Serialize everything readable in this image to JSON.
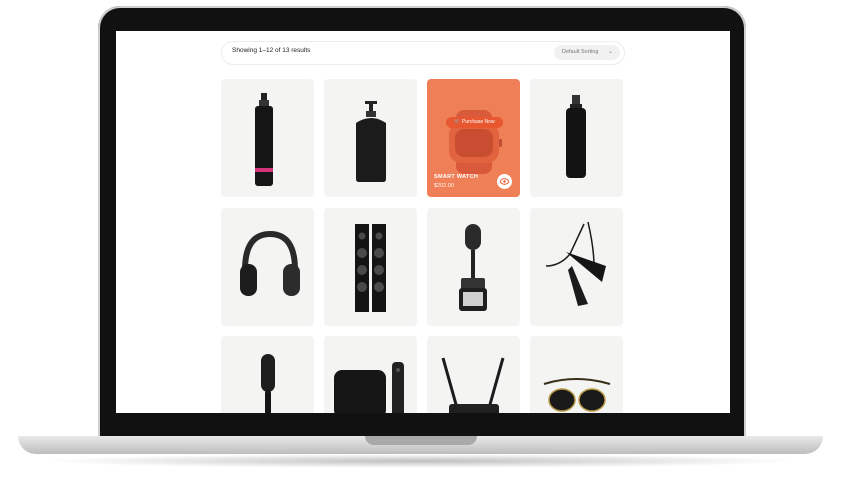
{
  "toolbar": {
    "result_count": "Showing 1–12 of 13 results",
    "sorting": "Default Sorting",
    "sort_icon": "chevron-down-icon"
  },
  "featured_product": {
    "button_label": "Purchase Now",
    "cart_icon": "cart-icon",
    "name": "SMART WATCH",
    "price": "$202.00",
    "quickview_icon": "eye-icon"
  },
  "colors": {
    "card_bg": "#f4f4f3",
    "accent": "#ef7f57",
    "button": "#e8572f"
  },
  "products": [
    {
      "image": "pump-bottle-pink-band"
    },
    {
      "image": "soap-dispenser"
    },
    {
      "image": "smart-watch"
    },
    {
      "image": "spray-bottle"
    },
    {
      "image": "headphones"
    },
    {
      "image": "tower-speaker"
    },
    {
      "image": "studio-microphone"
    },
    {
      "image": "hair-dryer"
    },
    {
      "image": "hair-brush"
    },
    {
      "image": "tv-box-with-remote"
    },
    {
      "image": "wifi-router"
    },
    {
      "image": "sunglasses"
    }
  ]
}
